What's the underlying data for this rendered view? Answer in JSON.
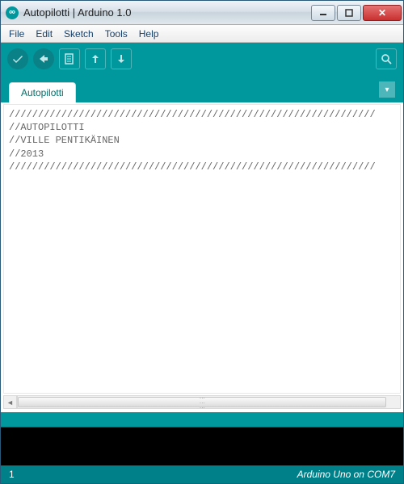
{
  "window": {
    "title": "Autopilotti | Arduino 1.0"
  },
  "menu": {
    "file": "File",
    "edit": "Edit",
    "sketch": "Sketch",
    "tools": "Tools",
    "help": "Help"
  },
  "tabs": {
    "active": "Autopilotti"
  },
  "code": {
    "line1": "///////////////////////////////////////////////////////////////",
    "line2": "//AUTOPILOTTI",
    "line3": "//VILLE PENTIKÄINEN",
    "line4": "//2013",
    "line5": "///////////////////////////////////////////////////////////////"
  },
  "status": {
    "line": "1",
    "board": "Arduino Uno on COM7"
  }
}
